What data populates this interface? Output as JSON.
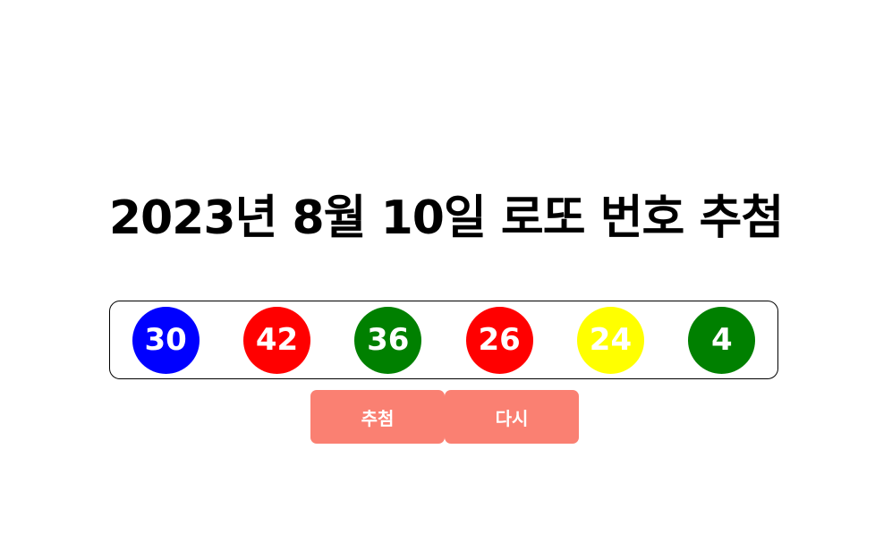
{
  "title": "2023년 8월 10일 로또 번호 추첨",
  "balls": [
    {
      "number": "30",
      "color": "#0000ff"
    },
    {
      "number": "42",
      "color": "#ff0000"
    },
    {
      "number": "36",
      "color": "#008000"
    },
    {
      "number": "26",
      "color": "#ff0000"
    },
    {
      "number": "24",
      "color": "#ffff00"
    },
    {
      "number": "4",
      "color": "#008000"
    }
  ],
  "buttons": {
    "draw_label": "추첨",
    "reset_label": "다시",
    "color": "#fa8072"
  }
}
